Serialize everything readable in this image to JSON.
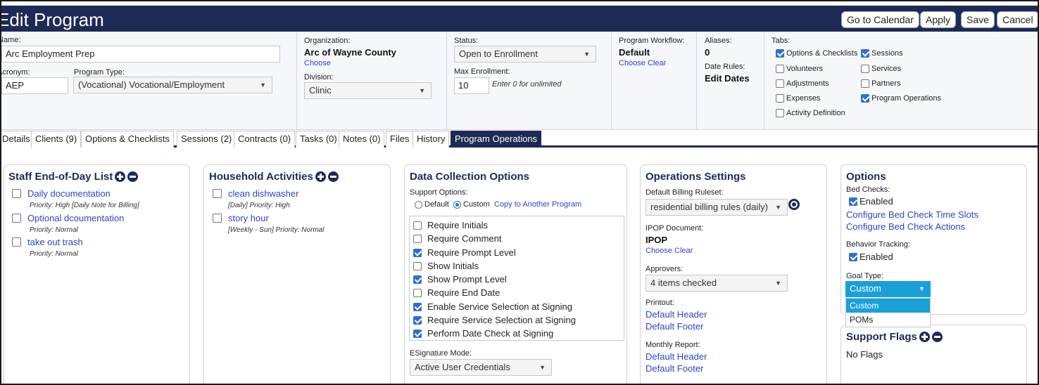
{
  "header": {
    "title": "Edit Program",
    "buttons": {
      "calendar": "Go to Calendar",
      "apply": "Apply",
      "save": "Save",
      "cancel": "Cancel"
    }
  },
  "form": {
    "name_label": "Name:",
    "name_value": "Arc Employment Prep",
    "acronym_label": "Acronym:",
    "acronym_value": "AEP",
    "program_type_label": "Program Type:",
    "program_type_value": "(Vocational) Vocational/Employment",
    "organization_label": "Organization:",
    "organization_value": "Arc of Wayne County",
    "organization_choose": "Choose",
    "division_label": "Division:",
    "division_value": "Clinic",
    "status_label": "Status:",
    "status_value": "Open to Enrollment",
    "max_enrollment_label": "Max Enrollment:",
    "max_enrollment_value": "10",
    "max_enrollment_hint": "Enter 0 for unlimited",
    "workflow_label": "Program Workflow:",
    "workflow_value": "Default",
    "workflow_choose": "Choose",
    "workflow_clear": "Clear",
    "aliases_label": "Aliases:",
    "aliases_value": "0",
    "date_rules_label": "Date Rules:",
    "date_rules_value": "Edit Dates",
    "tabs_label": "Tabs:",
    "tab_checks": [
      {
        "label": "Options & Checklists",
        "checked": true
      },
      {
        "label": "Volunteers",
        "checked": false
      },
      {
        "label": "Adjustments",
        "checked": false
      },
      {
        "label": "Expenses",
        "checked": false
      },
      {
        "label": "Activity Definition",
        "checked": false
      },
      {
        "label": "Sessions",
        "checked": true
      },
      {
        "label": "Services",
        "checked": false
      },
      {
        "label": "Partners",
        "checked": false
      },
      {
        "label": "Program Operations",
        "checked": true
      }
    ]
  },
  "tabs": [
    "Details",
    "Clients (9)",
    "Options & Checklists",
    "Sessions (2)",
    "Contracts (0)",
    "Tasks (0)",
    "Notes (0)",
    "Files",
    "History",
    "Program Operations"
  ],
  "staff_eod": {
    "title": "Staff End-of-Day List",
    "items": [
      {
        "label": "Daily documentation",
        "detail": "Priority: High [Daily Note for Billing]"
      },
      {
        "label": "Optional dcoumentation",
        "detail": "Priority: Normal"
      },
      {
        "label": "take out trash",
        "detail": "Priority: Normal"
      }
    ]
  },
  "household": {
    "title": "Household Activities",
    "items": [
      {
        "label": "clean dishwasher",
        "detail": "[Daily] Priority: High"
      },
      {
        "label": "story hour",
        "detail": "[Weekly - Sun] Priority: Normal"
      }
    ]
  },
  "data_collection": {
    "title": "Data Collection Options",
    "support_label": "Support Options:",
    "radio_default": "Default",
    "radio_custom": "Custom",
    "copy_link": "Copy to Another Program",
    "options": [
      {
        "label": "Require Initials",
        "checked": false
      },
      {
        "label": "Require Comment",
        "checked": false
      },
      {
        "label": "Require Prompt Level",
        "checked": true
      },
      {
        "label": "Show Initials",
        "checked": false
      },
      {
        "label": "Show Prompt Level",
        "checked": true
      },
      {
        "label": "Require End Date",
        "checked": false
      },
      {
        "label": "Enable Service Selection at Signing",
        "checked": true
      },
      {
        "label": "Require Service Selection at Signing",
        "checked": true
      },
      {
        "label": "Perform Date Check at Signing",
        "checked": true
      }
    ],
    "esig_label": "ESignature Mode:",
    "esig_value": "Active User Credentials"
  },
  "ops_settings": {
    "title": "Operations Settings",
    "billing_label": "Default Billing Ruleset:",
    "billing_value": "residential billing rules (daily)",
    "ipop_label": "IPOP Document:",
    "ipop_value": "IPOP",
    "ipop_choose": "Choose",
    "ipop_clear": "Clear",
    "approvers_label": "Approvers:",
    "approvers_value": "4 items checked",
    "printout_label": "Printout:",
    "printout_header": "Default Header",
    "printout_footer": "Default Footer",
    "monthly_label": "Monthly Report:",
    "monthly_header": "Default Header",
    "monthly_footer": "Default Footer"
  },
  "options": {
    "title": "Options",
    "bed_label": "Bed Checks:",
    "bed_enabled": "Enabled",
    "bed_slots": "Configure Bed Check Time Slots",
    "bed_actions": "Configure Bed Check Actions",
    "behavior_label": "Behavior Tracking:",
    "behavior_enabled": "Enabled",
    "goal_label": "Goal Type:",
    "goal_value": "Custom",
    "goal_options": [
      "Custom",
      "POMs"
    ]
  },
  "support_flags": {
    "title": "Support Flags",
    "empty": "No Flags"
  },
  "colors": {
    "navy": "#1e2a56",
    "link": "#2f44c7",
    "dropdown": "#1aa0d8"
  }
}
